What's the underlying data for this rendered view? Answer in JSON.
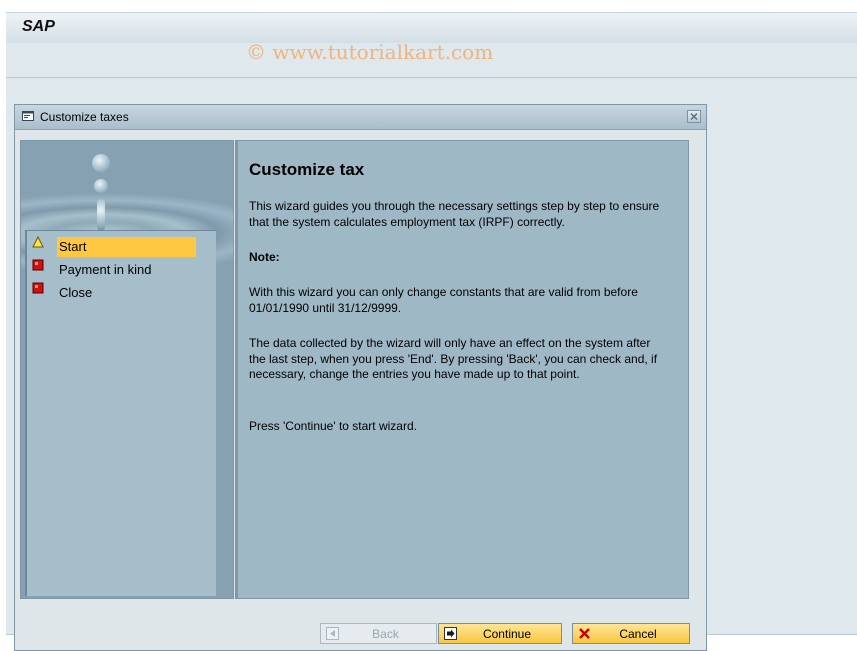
{
  "app": {
    "logo": "SAP",
    "watermark": "© www.tutorialkart.com"
  },
  "dialog": {
    "title": "Customize taxes",
    "close_icon": "close-icon"
  },
  "steps": [
    {
      "label": "Start",
      "icon": "warning-triangle-icon",
      "active": true
    },
    {
      "label": "Payment in kind",
      "icon": "red-stop-icon",
      "active": false
    },
    {
      "label": "Close",
      "icon": "red-stop-icon",
      "active": false
    }
  ],
  "content": {
    "title": "Customize tax",
    "intro": "This wizard guides you through the necessary settings step by step to ensure that the system calculates employment tax (IRPF) correctly.",
    "note_heading": "Note:",
    "note_text": "With this wizard you can only change constants that are valid from before 01/01/1990 until 31/12/9999.",
    "data_text": "The data collected by the wizard will only have an effect on the system after the last step, when you press 'End'. By pressing 'Back', you can check and, if necessary, change the entries you have made up to that point.",
    "continue_hint": "Press 'Continue' to start wizard."
  },
  "buttons": {
    "back": "Back",
    "continue": "Continue",
    "cancel": "Cancel"
  },
  "colors": {
    "active_step": "#ffc840",
    "button_yellow": "#f6c742",
    "panel_blue": "#9fb8c6"
  }
}
